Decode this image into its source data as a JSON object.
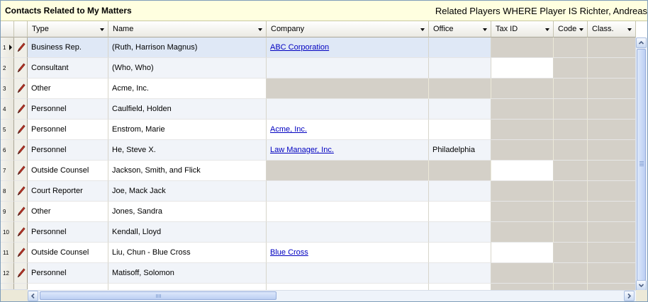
{
  "title": "Contacts Related to My Matters",
  "criteria": "Related Players WHERE Player IS Richter, Andreas",
  "columns": [
    {
      "label": "Type"
    },
    {
      "label": "Name"
    },
    {
      "label": "Company"
    },
    {
      "label": "Office"
    },
    {
      "label": "Tax ID"
    },
    {
      "label": "Code"
    },
    {
      "label": "Class."
    }
  ],
  "rows": [
    {
      "num": "1",
      "type": "Business Rep.",
      "name": "(Ruth, Harrison Magnus)",
      "company": "ABC Corporation",
      "office": ""
    },
    {
      "num": "2",
      "type": "Consultant",
      "name": "(Who, Who)",
      "company": "",
      "office": ""
    },
    {
      "num": "3",
      "type": "Other",
      "name": "Acme, Inc.",
      "company": "",
      "office": ""
    },
    {
      "num": "4",
      "type": "Personnel",
      "name": "Caulfield, Holden",
      "company": "",
      "office": ""
    },
    {
      "num": "5",
      "type": "Personnel",
      "name": "Enstrom, Marie",
      "company": "Acme, Inc.",
      "office": ""
    },
    {
      "num": "6",
      "type": "Personnel",
      "name": "He, Steve X.",
      "company": "Law Manager, Inc.",
      "office": "Philadelphia"
    },
    {
      "num": "7",
      "type": "Outside Counsel",
      "name": "Jackson, Smith, and Flick",
      "company": "",
      "office": ""
    },
    {
      "num": "8",
      "type": "Court Reporter",
      "name": "Joe, Mack Jack",
      "company": "",
      "office": ""
    },
    {
      "num": "9",
      "type": "Other",
      "name": "Jones, Sandra",
      "company": "",
      "office": ""
    },
    {
      "num": "10",
      "type": "Personnel",
      "name": "Kendall, Lloyd",
      "company": "",
      "office": ""
    },
    {
      "num": "11",
      "type": "Outside Counsel",
      "name": "Liu, Chun - Blue Cross",
      "company": "Blue Cross",
      "office": ""
    },
    {
      "num": "12",
      "type": "Personnel",
      "name": "Matisoff, Solomon",
      "company": "",
      "office": ""
    }
  ],
  "icons": {
    "row_edit": "pencil-icon",
    "current_row": "arrow-right-icon"
  },
  "colors": {
    "title_bg": "#ffffe0",
    "link": "#0000c0",
    "disabled_cell": "#d4d0c8",
    "selected_row": "#dfe8f6"
  }
}
